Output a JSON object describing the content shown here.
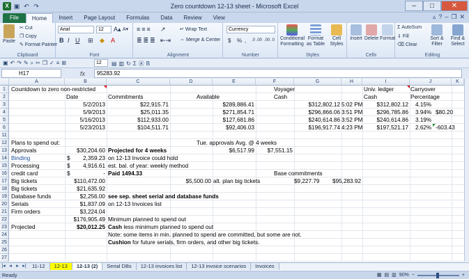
{
  "window": {
    "title": "Zero countdown 12-13 sheet - Microsoft Excel",
    "app_icon": "X"
  },
  "ribbon_tabs": [
    "File",
    "Home",
    "Insert",
    "Page Layout",
    "Formulas",
    "Data",
    "Review",
    "View"
  ],
  "ribbon": {
    "clipboard": {
      "paste": "Paste",
      "cut": "Cut",
      "copy": "Copy",
      "format_painter": "Format Painter",
      "label": "Clipboard"
    },
    "font": {
      "name": "Arial",
      "size": "12",
      "label": "Font",
      "bold": "B",
      "italic": "I",
      "underline": "U",
      "grow": "A",
      "shrink": "A"
    },
    "alignment": {
      "wrap": "Wrap Text",
      "merge": "Merge & Center",
      "label": "Alignment"
    },
    "number": {
      "format": "Currency",
      "dollar": "$",
      "percent": "%",
      "comma": ",",
      "inc": ".0 .00",
      "dec": ".00 .0",
      "label": "Number"
    },
    "styles": {
      "conditional": "Conditional Formatting",
      "format_table": "Format as Table",
      "cell_styles": "Cell Styles",
      "label": "Styles"
    },
    "cells": {
      "insert": "Insert",
      "delete": "Delete",
      "format": "Format",
      "label": "Cells"
    },
    "editing": {
      "autosum": "AutoSum",
      "fill": "Fill",
      "clear": "Clear",
      "sort": "Sort & Filter",
      "find": "Find & Select",
      "label": "Editing"
    }
  },
  "qat2": {
    "font_size": "12"
  },
  "formula_bar": {
    "name_box": "H17",
    "fx": "fx",
    "value": "95283.92"
  },
  "columns": [
    "A",
    "B",
    "C",
    "D",
    "E",
    "F",
    "G",
    "H",
    "I",
    "J",
    "K"
  ],
  "rows": [
    "1",
    "2",
    "3",
    "4",
    "5",
    "6",
    "11",
    "12",
    "13",
    "14",
    "15",
    "16",
    "17",
    "18",
    "19",
    "20",
    "21",
    "22",
    "23",
    "24",
    "25",
    "26",
    "27"
  ],
  "cells": {
    "r1": {
      "a": "Countdown to zero non-restricted",
      "g": "Voyager",
      "i": "Univ. ledger",
      "j": "Carryover"
    },
    "r2": {
      "b": "Date",
      "c": "Commitments",
      "e": "Available",
      "g": "Cash",
      "i": "Cash",
      "j": "Percentage"
    },
    "r3": {
      "b": "5/2/2013",
      "c": "$22,915.71",
      "e": "$289,886.41",
      "g": "$312,802.12",
      "h": "5:02 PM",
      "i": "$312,802.12",
      "j": "4.15%"
    },
    "r4": {
      "b": "5/9/2013",
      "c": "$25,011.35",
      "e": "$271,854.71",
      "g": "$296,866.06",
      "h": "3:51 PM",
      "i": "$296,785.86",
      "j": "3.94%",
      "k": "$80.20"
    },
    "r5": {
      "b": "5/16/2013",
      "c": "$112,933.00",
      "e": "$127,681.86",
      "g": "$240,614.86",
      "h": "3:52 PM",
      "i": "$240,614.86",
      "j": "3.19%"
    },
    "r6": {
      "b": "5/23/2013",
      "c": "$104,511.71",
      "e": "$92,406.03",
      "g": "$196,917.74",
      "h": "4:23 PM",
      "i": "$197,521.17",
      "j": "2.62%",
      "k": "-603.43"
    },
    "r12": {
      "a": "Plans to spend out:",
      "e": "Tue. approvals",
      "f": "Avg. @ 4 weeks"
    },
    "r13": {
      "a": "Approvals",
      "b": "$30,204.60",
      "c": "Projected for 4 weeks",
      "e": "$6,517.99",
      "f": "$7,551.15"
    },
    "r14": {
      "a": "Binding",
      "b1": "$",
      "b": "2,359.23",
      "c": "on 12-13 Invoice could hold"
    },
    "r15": {
      "a": "Processing",
      "b1": "$",
      "b": "4,916.61",
      "c": "est. bal. of year: weekly method"
    },
    "r16": {
      "a": "credit card",
      "b1": "$",
      "b": "-",
      "c": "Paid 1494.33",
      "g": "Base commitments"
    },
    "r17": {
      "a": "Big tickets",
      "b": "$110,472.00",
      "d": "$5,500.00",
      "e": "alt. plan big tickets",
      "g": "$9,227.79",
      "h": "$95,283.92"
    },
    "r18": {
      "a": "Big tickets",
      "b": "$21,635.92"
    },
    "r19": {
      "a": "Database funds",
      "b": "$2,256.00",
      "c": "see sep. sheet serial and database funds"
    },
    "r20": {
      "a": "Serials",
      "b": "$1,837.09",
      "c": "on 12-13 Invoices list"
    },
    "r21": {
      "a": "Firm orders",
      "b": "$3,224.04"
    },
    "r22": {
      "b": "$176,905.49",
      "c": "Minimum planned to spend out"
    },
    "r23": {
      "a": "Projected",
      "b": "$20,012.25",
      "c1": "Cash",
      "c": "less minimum planned to spend out"
    },
    "r24": {
      "c": "Note: some items in min. planned to spend are committed, but some are not."
    },
    "r25": {
      "c1": "Cushion",
      "c": "for future serials, firm orders, and other big tickets."
    }
  },
  "sheet_tabs": [
    "11-12",
    "12-13",
    "12-13 (2)",
    "Serial DBs",
    "12-13 invoices list",
    "12-13 invoice scenarios",
    "Invoices"
  ],
  "status": {
    "text": "Ready",
    "zoom": "90%"
  }
}
